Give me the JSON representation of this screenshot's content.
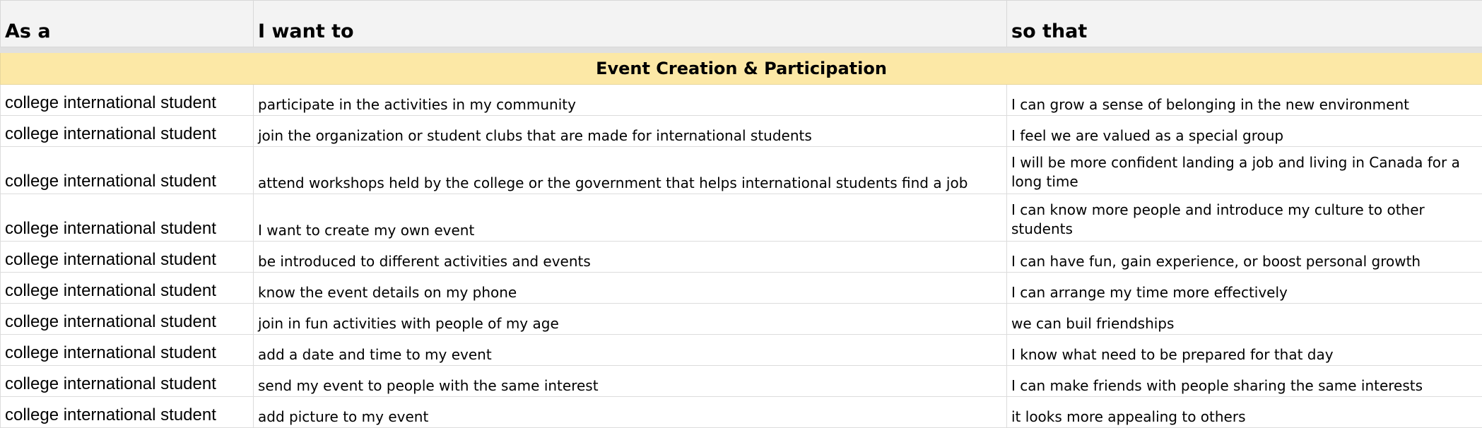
{
  "headers": [
    "As a",
    "I want to",
    "so that"
  ],
  "section": "Event Creation & Participation",
  "rows": [
    {
      "as_a": "college international student",
      "want": "participate in the activities in my community",
      "so_that": "I can grow a sense of belonging in the new environment",
      "tall": false
    },
    {
      "as_a": "college international student",
      "want": "join the organization or student clubs that are made for international students",
      "so_that": "I feel we are valued as a special group",
      "tall": false
    },
    {
      "as_a": "college international student",
      "want": "attend workshops held by the college or the government that helps international students find a job",
      "so_that": "I will be more confident landing a job and living in Canada for a long time",
      "tall": true
    },
    {
      "as_a": "college international student",
      "want": "I want to create my own event",
      "so_that": "I can know more people and introduce my culture to other students",
      "tall": true
    },
    {
      "as_a": "college international student",
      "want": "be introduced to different activities and events",
      "so_that": "I can have fun, gain experience, or boost personal growth",
      "tall": false
    },
    {
      "as_a": "college international student",
      "want": "know the event details on my phone",
      "so_that": "I can arrange my time more effectively",
      "tall": false
    },
    {
      "as_a": "college international student",
      "want": "join in fun activities with people of my age",
      "so_that": "we can buil friendships",
      "tall": false
    },
    {
      "as_a": "college international student",
      "want": "add a date and time to my event",
      "so_that": "I know what need to be prepared for that day",
      "tall": false
    },
    {
      "as_a": "college international student",
      "want": "send my event to people with the same interest",
      "so_that": "I can make friends with people sharing the same interests",
      "tall": false
    },
    {
      "as_a": "college international student",
      "want": "add picture to my event",
      "so_that": "it looks more appealing to others",
      "tall": false
    }
  ]
}
